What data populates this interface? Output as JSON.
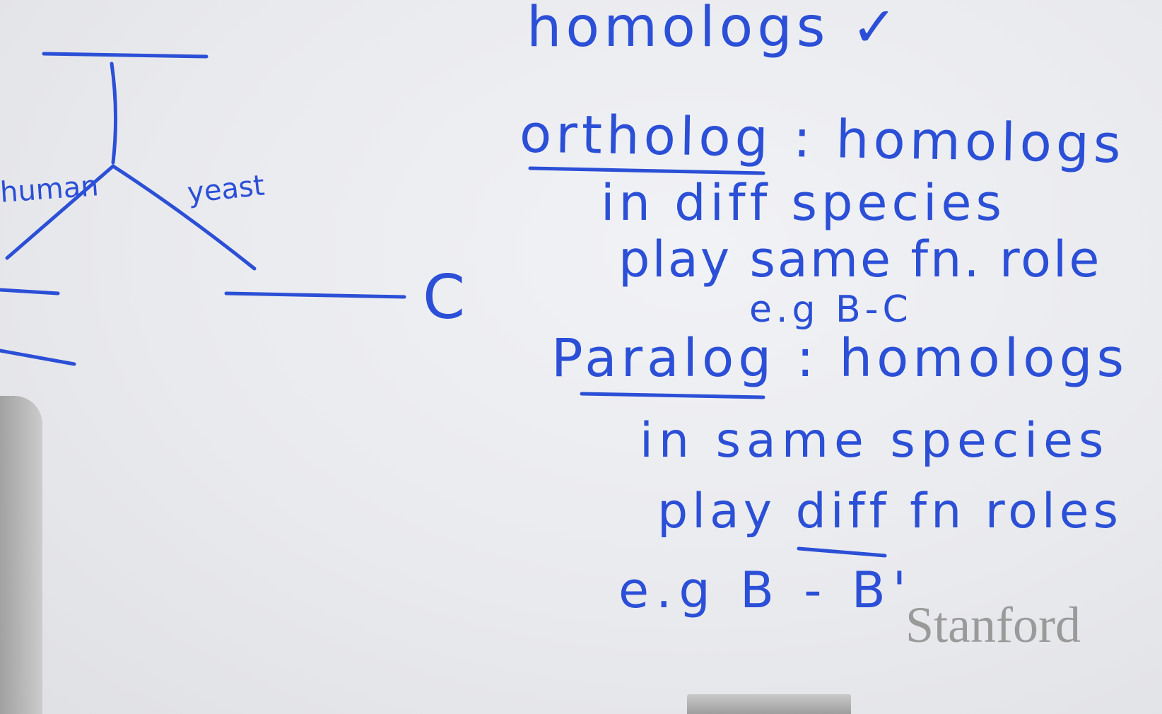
{
  "tree": {
    "left_branch_label": "human",
    "right_branch_label": "yeast",
    "leaf_c_label": "C"
  },
  "notes": {
    "line1": "homologs ✓",
    "line2": "ortholog : homologs",
    "line3": "in diff species",
    "line4": "play same fn. role",
    "line5": "e.g B-C",
    "line6": "Paralog : homologs",
    "line7": "in same species",
    "line8": "play diff fn roles",
    "line9": "e.g B - B'"
  },
  "watermark": {
    "text": "Stanford",
    "color": "#9a9a9a"
  },
  "colors": {
    "marker": "#2b4fd6",
    "board": "#ebecf0"
  }
}
